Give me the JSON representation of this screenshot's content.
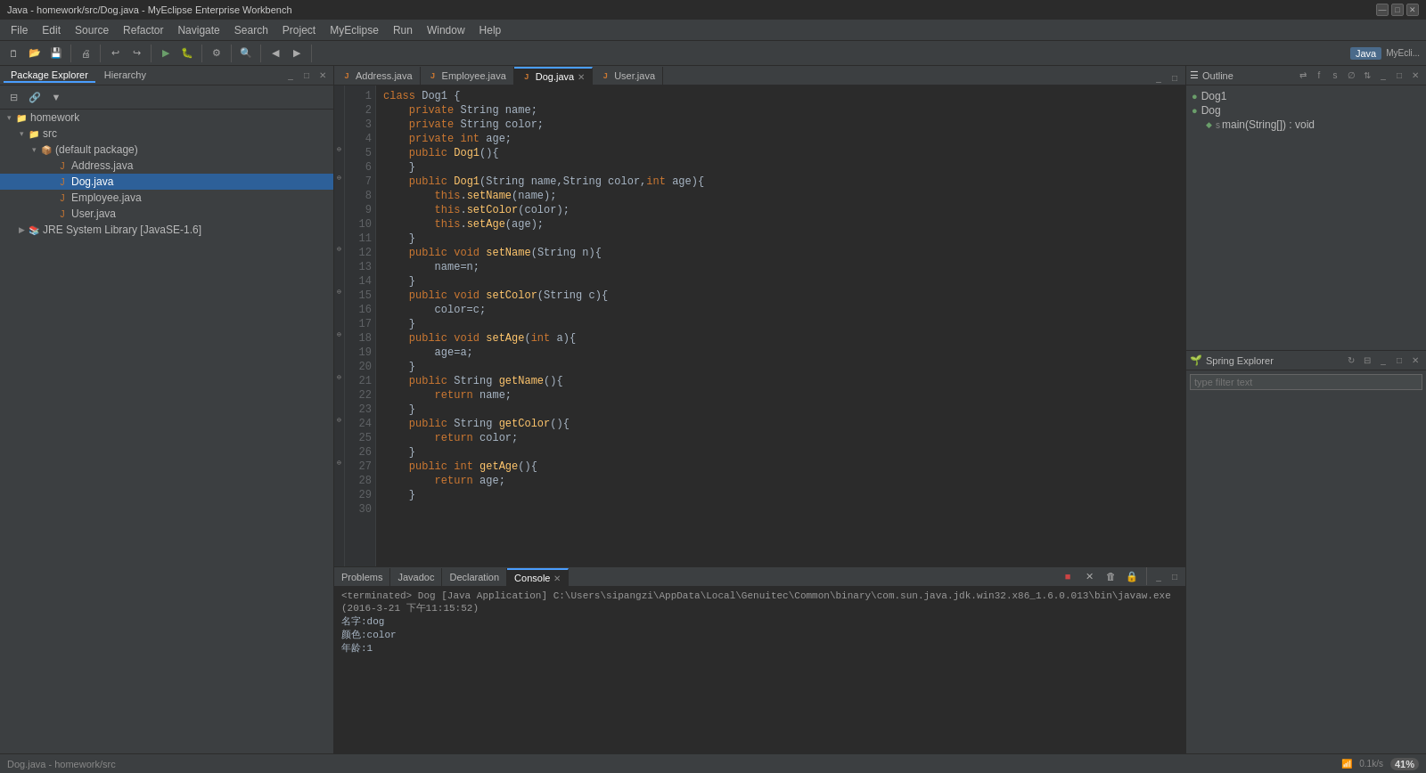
{
  "titlebar": {
    "title": "Java - homework/src/Dog.java - MyEclipse Enterprise Workbench",
    "minimize": "—",
    "maximize": "□",
    "close": "✕"
  },
  "menubar": {
    "items": [
      "File",
      "Edit",
      "Source",
      "Refactor",
      "Navigate",
      "Search",
      "Project",
      "MyEclipse",
      "Run",
      "Window",
      "Help"
    ]
  },
  "package_explorer": {
    "tab_label": "Package Explorer",
    "hierarchy_tab": "Hierarchy",
    "tree": {
      "homework": "homework",
      "src": "src",
      "default_package": "(default package)",
      "address_java": "Address.java",
      "dog_java": "Dog.java",
      "employee_java": "Employee.java",
      "user_java": "User.java",
      "jre": "JRE System Library [JavaSE-1.6]"
    }
  },
  "editor": {
    "tabs": [
      {
        "label": "Address.java",
        "icon": "J"
      },
      {
        "label": "Employee.java",
        "icon": "J"
      },
      {
        "label": "Dog.java",
        "icon": "J",
        "active": true
      },
      {
        "label": "User.java",
        "icon": "J"
      }
    ],
    "code": [
      "class Dog1 {",
      "    private String name;",
      "    private String color;",
      "    private int age;",
      "    public Dog1(){",
      "    }",
      "    public Dog1(String name,String color,int age){",
      "        this.setName(name);",
      "        this.setColor(color);",
      "        this.setAge(age);",
      "    }",
      "    public void setName(String n){",
      "        name=n;",
      "    }",
      "    public void setColor(String c){",
      "        color=c;",
      "    }",
      "    public void setAge(int a){",
      "        age=a;",
      "    }",
      "    public String getName(){",
      "        return name;",
      "    }",
      "    public String getColor(){",
      "        return color;",
      "    }",
      "    public int getAge(){",
      "        return age;",
      "    }"
    ]
  },
  "outline": {
    "title": "Outline",
    "items": [
      {
        "label": "Dog1",
        "type": "class",
        "indent": 0
      },
      {
        "label": "Dog",
        "type": "class",
        "indent": 0
      },
      {
        "label": "main(String[]) : void",
        "type": "method",
        "indent": 1
      }
    ]
  },
  "spring_explorer": {
    "title": "Spring Explorer",
    "filter_placeholder": "type filter text"
  },
  "bottom_panel": {
    "tabs": [
      "Problems",
      "Javadoc",
      "Declaration",
      "Console"
    ],
    "active_tab": "Console",
    "console": {
      "terminated_line": "<terminated> Dog [Java Application] C:\\Users\\sipangzi\\AppData\\Local\\Genuitec\\Common\\binary\\com.sun.java.jdk.win32.x86_1.6.0.013\\bin\\javaw.exe (2016-3-21 下午11:15:52)",
      "output_lines": [
        "名字:dog",
        "颜色:color",
        "年龄:1"
      ]
    }
  },
  "statusbar": {
    "left": "Dog.java - homework/src",
    "network": "0.1k/s",
    "cpu": "41%"
  },
  "perspective": {
    "java_label": "Java",
    "myecli_label": "MyEcli..."
  }
}
